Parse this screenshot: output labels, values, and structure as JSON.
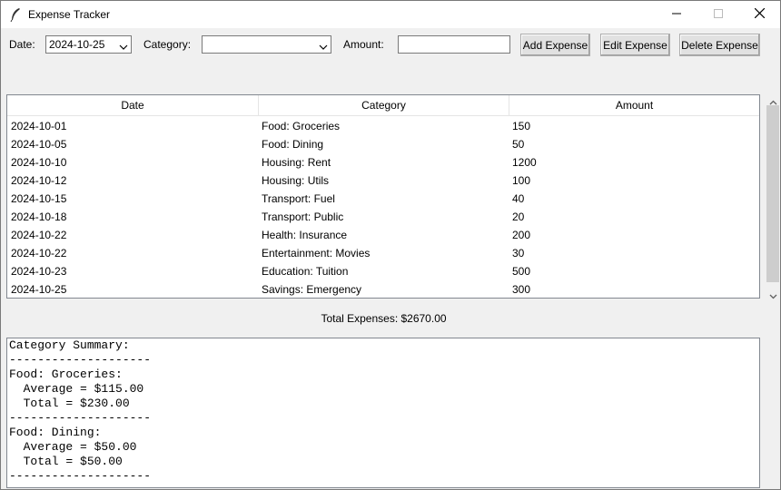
{
  "window": {
    "title": "Expense Tracker"
  },
  "toolbar": {
    "date_label": "Date:",
    "date_value": "2024-10-25",
    "category_label": "Category:",
    "category_value": "",
    "amount_label": "Amount:",
    "amount_value": "",
    "add_label": "Add Expense",
    "edit_label": "Edit Expense",
    "delete_label": "Delete Expense"
  },
  "table": {
    "columns": [
      "Date",
      "Category",
      "Amount"
    ],
    "rows": [
      [
        "2024-10-01",
        "Food: Groceries",
        "150"
      ],
      [
        "2024-10-05",
        "Food: Dining",
        "50"
      ],
      [
        "2024-10-10",
        "Housing: Rent",
        "1200"
      ],
      [
        "2024-10-12",
        "Housing: Utils",
        "100"
      ],
      [
        "2024-10-15",
        "Transport: Fuel",
        "40"
      ],
      [
        "2024-10-18",
        "Transport: Public",
        "20"
      ],
      [
        "2024-10-22",
        "Health: Insurance",
        "200"
      ],
      [
        "2024-10-22",
        "Entertainment: Movies",
        "30"
      ],
      [
        "2024-10-23",
        "Education: Tuition",
        "500"
      ],
      [
        "2024-10-25",
        "Savings: Emergency",
        "300"
      ]
    ]
  },
  "total_text": "Total Expenses: $2670.00",
  "summary": {
    "lines": [
      "Category Summary:",
      "--------------------",
      "Food: Groceries:",
      "  Average = $115.00",
      "  Total = $230.00",
      "--------------------",
      "Food: Dining:",
      "  Average = $50.00",
      "  Total = $50.00",
      "--------------------"
    ]
  },
  "colors": {
    "window_bg": "#f0f0f0",
    "button_bg": "#e1e1e1",
    "border": "#7a7a7a"
  },
  "icons": [
    "feather-icon",
    "minimize-icon",
    "maximize-icon",
    "close-icon",
    "chevron-down-icon",
    "scroll-up-icon",
    "scroll-down-icon"
  ]
}
